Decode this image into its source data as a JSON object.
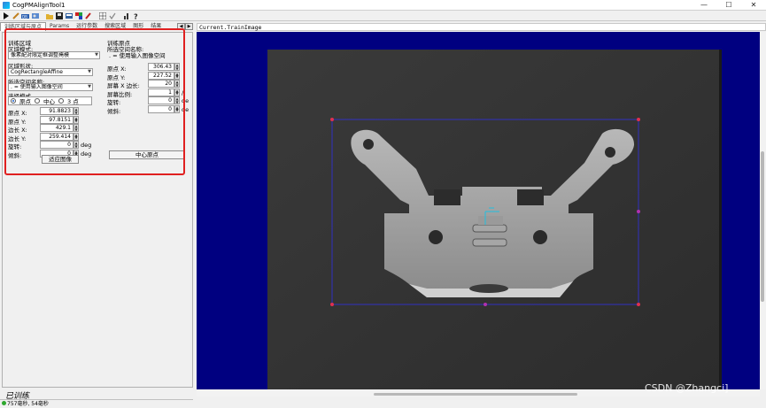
{
  "window": {
    "title": "CogPMAlignTool1",
    "controls": [
      "—",
      "☐",
      "✕"
    ]
  },
  "toolbar": {
    "icons": [
      "run-icon",
      "edit-icon",
      "cam-icon",
      "image-icon",
      "open-icon",
      "save-icon",
      "export-icon",
      "color-icon",
      "grid-icon",
      "check-icon",
      "chart-icon",
      "help-icon"
    ]
  },
  "tabs": [
    "训练区域与原点",
    "Params",
    "运行参数",
    "搜索区域",
    "图形",
    "结果"
  ],
  "train_region": {
    "group_label": "训练区域",
    "mode_label": "区域模式:",
    "mode_value": "像素配对限定框调整掩模",
    "shape_label": "区域形状:",
    "shape_value": "CogRectangleAffine",
    "space_label": "所选空间名称:",
    "space_value": ". = 使用输入图像空间",
    "select_mode_label": "选择模式",
    "radio_origin": "原点",
    "radio_center": "中心",
    "radio_3pt": "3 点",
    "fields": [
      {
        "label": "原点 X:",
        "value": "91.8823",
        "unit": ""
      },
      {
        "label": "原点 Y:",
        "value": "97.8151",
        "unit": ""
      },
      {
        "label": "边长 X:",
        "value": "429.1",
        "unit": ""
      },
      {
        "label": "边长 Y:",
        "value": "259.414",
        "unit": ""
      },
      {
        "label": "旋转:",
        "value": "0",
        "unit": "deg"
      },
      {
        "label": "倾斜:",
        "value": "0",
        "unit": "deg"
      }
    ],
    "fit_button": "适应图像"
  },
  "train_origin": {
    "group_label": "训练原点",
    "space_label": "所选空间名称:",
    "space_value": ". = 使用输入图像空间",
    "fields": [
      {
        "label": "原点 X:",
        "value": "306.43",
        "unit": ""
      },
      {
        "label": "原点 Y:",
        "value": "227.52",
        "unit": ""
      },
      {
        "label": "屏幕 X 边长:",
        "value": "20",
        "unit": ""
      },
      {
        "label": "屏幕比例:",
        "value": "1",
        "unit": "/"
      },
      {
        "label": "旋转:",
        "value": "0",
        "unit": "de"
      },
      {
        "label": "倾斜:",
        "value": "0",
        "unit": "de"
      }
    ],
    "center_button": "中心原点"
  },
  "status": {
    "trained": "已训练",
    "timing": "757毫秒, 54毫秒"
  },
  "image": {
    "header": "Current.TrainImage",
    "watermark": "CSDN @Zhangci]"
  },
  "colors": {
    "display_bg": "#000080",
    "highlight": "#e02020",
    "region_box": "#3030c0"
  }
}
